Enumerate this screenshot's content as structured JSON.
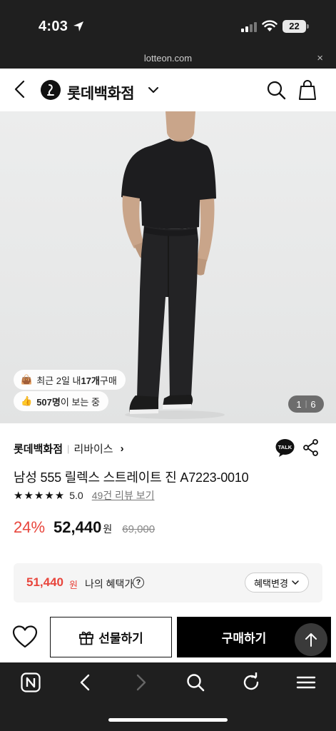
{
  "status": {
    "time": "4:03",
    "battery": "22"
  },
  "browser": {
    "url": "lotteon.com",
    "close_label": "×"
  },
  "header": {
    "brand": "롯데백화점"
  },
  "hero": {
    "buy_prefix": "최근 2일 내 ",
    "buy_count": "17개",
    "buy_suffix": " 구매",
    "view_count": "507명",
    "view_suffix": "이 보는 중",
    "page_current": "1",
    "page_total": "6"
  },
  "seller": {
    "store": "롯데백화점",
    "brand": "리바이스"
  },
  "product": {
    "title": "남성 555 릴렉스 스트레이트 진 A7223-0010",
    "stars": "★★★★★",
    "score": "5.0",
    "reviews": "49건 리뷰 보기",
    "discount": "24%",
    "price": "52,440",
    "currency": "원",
    "original_price": "69,000"
  },
  "benefit": {
    "price": "51,440",
    "currency": "원",
    "label": "나의 혜택가",
    "change_label": "혜택변경"
  },
  "actions": {
    "gift_label": "선물하기",
    "buy_label": "구매하기"
  },
  "colors": {
    "accent": "#e8453c",
    "dark": "#1f1f1f"
  }
}
